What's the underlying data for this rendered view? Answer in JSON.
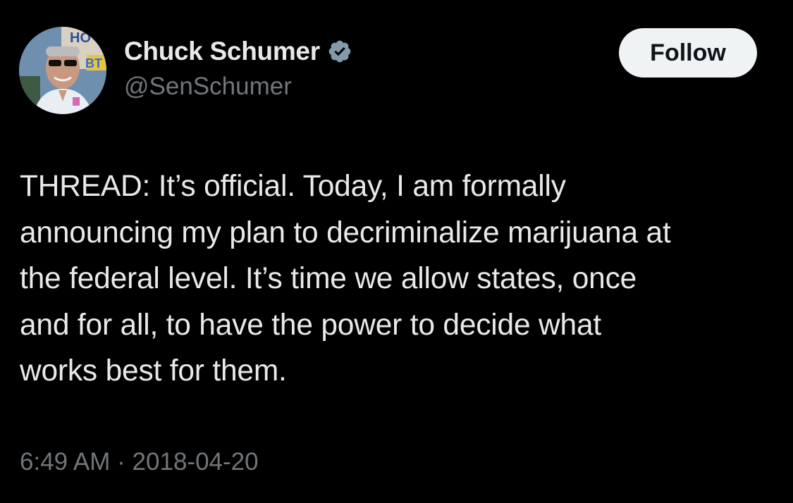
{
  "author": {
    "display_name": "Chuck Schumer",
    "handle": "@SenSchumer",
    "verified_icon": "verified-badge-icon",
    "avatar_icon": "profile-photo"
  },
  "follow_button": {
    "label": "Follow"
  },
  "tweet": {
    "text": "THREAD: It’s official. Today, I am formally\nannouncing my plan to decriminalize marijuana at\nthe federal level. It’s time we allow states, once\nand for all, to have the power to decide what\nworks best for them.",
    "time": "6:49 AM",
    "separator": "·",
    "date": "2018-04-20"
  },
  "colors": {
    "background": "#000000",
    "primary_text": "#e7e9ea",
    "secondary_text": "#71767b",
    "follow_button_bg": "#eff3f4",
    "follow_button_text": "#0f1419",
    "verified": "#829aab"
  }
}
